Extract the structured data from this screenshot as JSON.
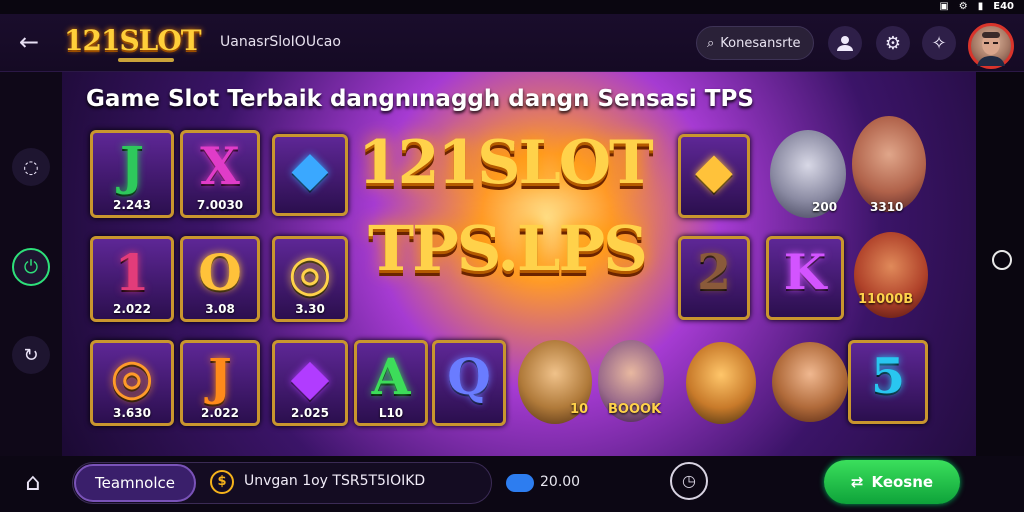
{
  "status": {
    "right": [
      "▣",
      "⚙",
      "▮",
      "E40"
    ]
  },
  "header": {
    "logo": "121SLOT",
    "url": "UanasrSloIOUcao",
    "search_placeholder": "Konesansrte"
  },
  "banner": {
    "title": "Game Slot Terbaik dangnınaggh dangn Sensasi TPS",
    "headline_1": "121SLOT",
    "headline_2": "TPS.LPS",
    "tiles": [
      {
        "id": "t1",
        "glyph": "J",
        "value": "2.243",
        "color": "#2ec95c"
      },
      {
        "id": "t2",
        "glyph": "X",
        "value": "7.0030",
        "color": "#e03cc8"
      },
      {
        "id": "t3",
        "glyph": "◆",
        "value": "",
        "color": "#3aa8ff"
      },
      {
        "id": "t4",
        "glyph": "1",
        "value": "2.022",
        "color": "#e23c7a"
      },
      {
        "id": "t5",
        "glyph": "O",
        "value": "3.08",
        "color": "#ffc23a"
      },
      {
        "id": "t6",
        "glyph": "◎",
        "value": "3.30",
        "color": "#ffd24a"
      },
      {
        "id": "t7",
        "glyph": "◆",
        "value": "",
        "color": "#ffc23a"
      },
      {
        "id": "t8",
        "glyph": "2",
        "value": "",
        "color": "#8a5a3a"
      },
      {
        "id": "t9",
        "glyph": "K",
        "value": "",
        "color": "#d354ff"
      },
      {
        "id": "t10",
        "glyph": "J",
        "value": "3.300",
        "color": "#e03cc8"
      },
      {
        "id": "t11",
        "glyph": "◎",
        "value": "3.630",
        "color": "#ff9a2a"
      },
      {
        "id": "t12",
        "glyph": "J",
        "value": "2.022",
        "color": "#ff8a1a"
      },
      {
        "id": "t13",
        "glyph": "◆",
        "value": "2.025",
        "color": "#b13cff"
      },
      {
        "id": "t14",
        "glyph": "A",
        "value": "L10",
        "color": "#3ddc5a"
      },
      {
        "id": "t15",
        "glyph": "Q",
        "value": "",
        "color": "#6a7cff"
      },
      {
        "id": "t16",
        "glyph": "5",
        "value": "",
        "color": "#29c6f0"
      }
    ],
    "character_labels": [
      "200",
      "3310",
      "11000B",
      "BOOOK",
      "10"
    ]
  },
  "bottom": {
    "pill_button": "Teamnolce",
    "pill_text": "Unvgan 1oy TSR5T5IOIKD",
    "balance": "20.00",
    "go_button": "Keosne"
  }
}
